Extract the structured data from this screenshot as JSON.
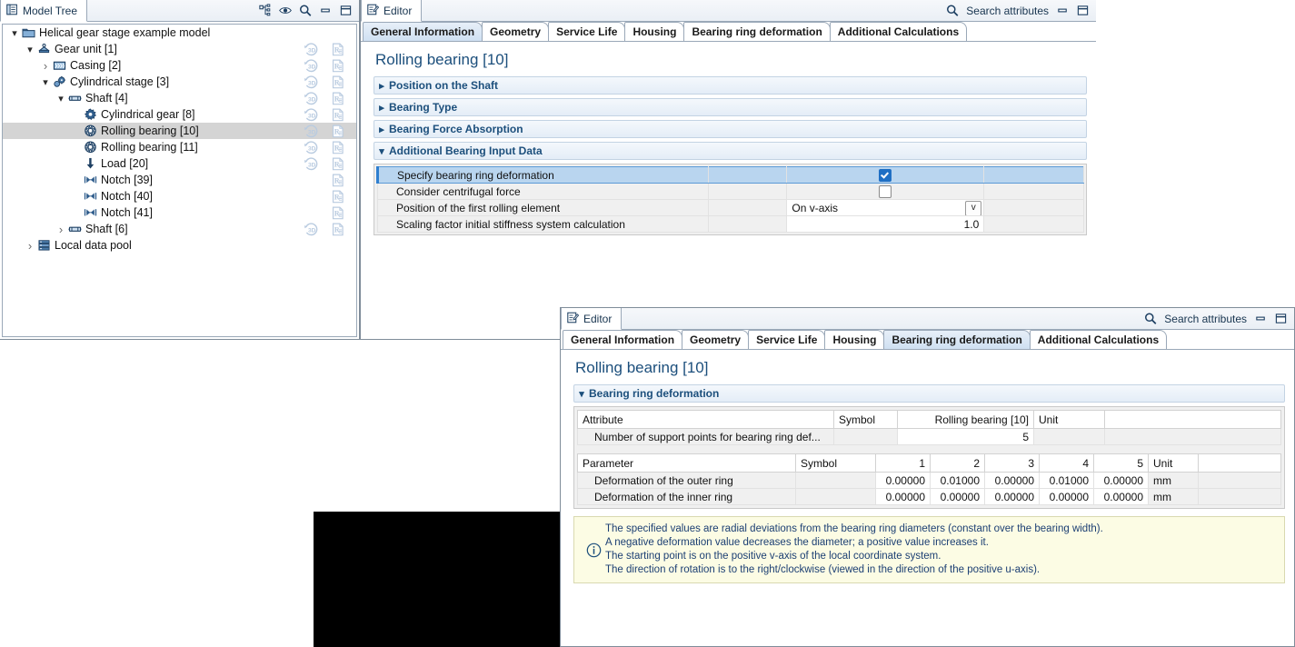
{
  "model_tree": {
    "title": "Model Tree",
    "toolbar": [
      {
        "name": "link-hierarchy-icon",
        "label": "Link with editor"
      },
      {
        "name": "eye-icon",
        "label": "Show"
      },
      {
        "name": "search-icon",
        "label": "Search"
      },
      {
        "name": "minimize-icon",
        "label": "Minimize"
      },
      {
        "name": "maximize-icon",
        "label": "Maximize"
      }
    ],
    "items": [
      {
        "label": "Helical gear stage example model",
        "depth": 0,
        "twisty": "open",
        "icon": "folder-icon",
        "selected": false,
        "has_3d": false,
        "has_report": false
      },
      {
        "label": "Gear unit [1]",
        "depth": 1,
        "twisty": "open",
        "icon": "gear-unit-icon",
        "selected": false,
        "has_3d": true,
        "has_report": true
      },
      {
        "label": "Casing [2]",
        "depth": 2,
        "twisty": "closed",
        "icon": "casing-icon",
        "selected": false,
        "has_3d": true,
        "has_report": true
      },
      {
        "label": "Cylindrical stage [3]",
        "depth": 2,
        "twisty": "open",
        "icon": "cylindrical-stage-icon",
        "selected": false,
        "has_3d": true,
        "has_report": true
      },
      {
        "label": "Shaft [4]",
        "depth": 3,
        "twisty": "open",
        "icon": "shaft-icon",
        "selected": false,
        "has_3d": true,
        "has_report": true
      },
      {
        "label": "Cylindrical gear [8]",
        "depth": 4,
        "twisty": "none",
        "icon": "cylindrical-gear-icon",
        "selected": false,
        "has_3d": true,
        "has_report": true
      },
      {
        "label": "Rolling bearing [10]",
        "depth": 4,
        "twisty": "none",
        "icon": "rolling-bearing-icon",
        "selected": true,
        "has_3d": true,
        "has_report": true
      },
      {
        "label": "Rolling bearing [11]",
        "depth": 4,
        "twisty": "none",
        "icon": "rolling-bearing-icon",
        "selected": false,
        "has_3d": true,
        "has_report": true
      },
      {
        "label": "Load [20]",
        "depth": 4,
        "twisty": "none",
        "icon": "load-arrow-icon",
        "selected": false,
        "has_3d": true,
        "has_report": true
      },
      {
        "label": "Notch [39]",
        "depth": 4,
        "twisty": "none",
        "icon": "notch-icon",
        "selected": false,
        "has_3d": false,
        "has_report": true
      },
      {
        "label": "Notch [40]",
        "depth": 4,
        "twisty": "none",
        "icon": "notch-icon",
        "selected": false,
        "has_3d": false,
        "has_report": true
      },
      {
        "label": "Notch [41]",
        "depth": 4,
        "twisty": "none",
        "icon": "notch-icon",
        "selected": false,
        "has_3d": false,
        "has_report": true
      },
      {
        "label": "Shaft [6]",
        "depth": 3,
        "twisty": "closed",
        "icon": "shaft-icon",
        "selected": false,
        "has_3d": true,
        "has_report": true
      },
      {
        "label": "Local data pool",
        "depth": 1,
        "twisty": "closed",
        "icon": "data-pool-icon",
        "selected": false,
        "has_3d": false,
        "has_report": false
      }
    ]
  },
  "editor1": {
    "window_title": "Editor",
    "search_label": "Search attributes",
    "tabs": [
      {
        "label": "General Information",
        "active": true
      },
      {
        "label": "Geometry",
        "active": false
      },
      {
        "label": "Service Life",
        "active": false
      },
      {
        "label": "Housing",
        "active": false
      },
      {
        "label": "Bearing ring deformation",
        "active": false
      },
      {
        "label": "Additional Calculations",
        "active": false
      }
    ],
    "page_title": "Rolling bearing [10]",
    "sections": [
      {
        "label": "Position on the Shaft",
        "expanded": false
      },
      {
        "label": "Bearing Type",
        "expanded": false
      },
      {
        "label": "Bearing Force Absorption",
        "expanded": false
      },
      {
        "label": "Additional Bearing Input Data",
        "expanded": true
      }
    ],
    "additional_bearing_input_data": {
      "rows": [
        {
          "label": "Specify bearing ring deformation",
          "type": "checkbox",
          "checked": true,
          "highlighted": true
        },
        {
          "label": "Consider centrifugal force",
          "type": "checkbox",
          "checked": false,
          "highlighted": false
        },
        {
          "label": "Position of the first rolling element",
          "type": "combo",
          "value": "On v-axis",
          "highlighted": false
        },
        {
          "label": "Scaling factor initial stiffness system calculation",
          "type": "number",
          "value": "1.0",
          "highlighted": false
        }
      ]
    }
  },
  "editor2": {
    "window_title": "Editor",
    "search_label": "Search attributes",
    "tabs": [
      {
        "label": "General Information",
        "active": false
      },
      {
        "label": "Geometry",
        "active": false
      },
      {
        "label": "Service Life",
        "active": false
      },
      {
        "label": "Housing",
        "active": false
      },
      {
        "label": "Bearing ring deformation",
        "active": true
      },
      {
        "label": "Additional Calculations",
        "active": false
      }
    ],
    "page_title": "Rolling bearing [10]",
    "section": {
      "label": "Bearing ring deformation",
      "expanded": true
    },
    "attribute_table": {
      "headers": [
        "Attribute",
        "Symbol",
        "Rolling bearing [10]",
        "Unit",
        ""
      ],
      "rows": [
        {
          "name": "Number of support points for bearing ring def...",
          "symbol": "",
          "value": "5",
          "unit": ""
        }
      ]
    },
    "parameter_table": {
      "headers": [
        "Parameter",
        "Symbol",
        "1",
        "2",
        "3",
        "4",
        "5",
        "Unit",
        ""
      ],
      "rows": [
        {
          "name": "Deformation of the outer ring",
          "symbol": "",
          "values": [
            "0.00000",
            "0.01000",
            "0.00000",
            "0.01000",
            "0.00000"
          ],
          "unit": "mm"
        },
        {
          "name": "Deformation of the inner ring",
          "symbol": "",
          "values": [
            "0.00000",
            "0.00000",
            "0.00000",
            "0.00000",
            "0.00000"
          ],
          "unit": "mm"
        }
      ]
    },
    "note": {
      "icon": "info-icon",
      "lines": [
        "The specified values are radial deviations from the bearing ring diameters (constant over the bearing width).",
        "A negative deformation value decreases the diameter; a positive value increases it.",
        "The starting point is on the positive v-axis of the local coordinate system.",
        "The direction of rotation is to the right/clockwise (viewed in the direction of the positive u-axis)."
      ]
    }
  },
  "viewport_3d": {
    "name": "3d-viewport",
    "background": "#000000"
  },
  "colors": {
    "accent_blue": "#1c4f7c",
    "selection_blue": "#b9d5ef",
    "tree_selection_gray": "#d4d4d4",
    "note_yellow": "#fcfce4",
    "checkbox_checked": "#1f6fc4"
  }
}
